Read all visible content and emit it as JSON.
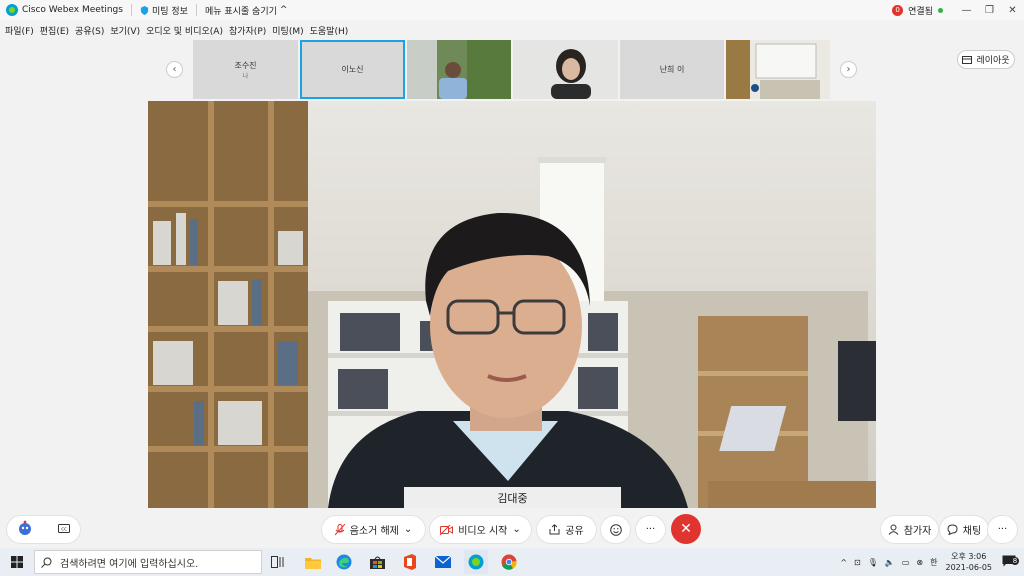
{
  "titlebar": {
    "app_title": "Cisco Webex Meetings",
    "meeting_info": "미팅 정보",
    "menu_toggle": "메뉴 표시줄 숨기기",
    "connection_count": "0",
    "connection_label": "연결됨"
  },
  "menu": [
    "파일(F)",
    "편집(E)",
    "공유(S)",
    "보기(V)",
    "오디오 및 비디오(A)",
    "참가자(P)",
    "미팅(M)",
    "도움말(H)"
  ],
  "participants": [
    {
      "name": "조수진",
      "sub": "나"
    },
    {
      "name": "이노신",
      "sub": ""
    },
    {
      "name": "",
      "sub": ""
    },
    {
      "name": "",
      "sub": ""
    },
    {
      "name": "난희 이",
      "sub": ""
    },
    {
      "name": "",
      "sub": ""
    }
  ],
  "layout_button": "레이아웃",
  "speaker_name": "김대중",
  "controls": {
    "mute": "음소거 해제",
    "video": "비디오 시작",
    "share": "공유",
    "participants": "참가자",
    "chat": "채팅"
  },
  "taskbar": {
    "search_placeholder": "검색하려면 여기에 입력하십시오.",
    "ime": "한",
    "time": "오후 3:06",
    "date": "2021-06-05",
    "notifications": "8"
  },
  "colors": {
    "accent": "#1aa1e6",
    "end_call": "#e0342f",
    "connected": "#2fb344"
  }
}
